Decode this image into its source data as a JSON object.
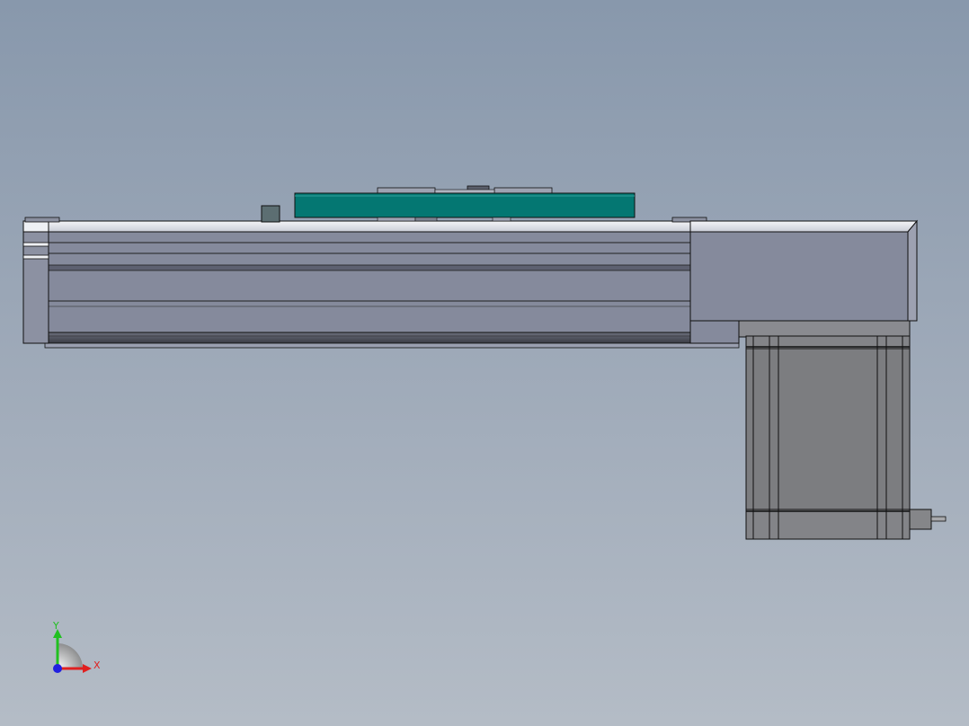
{
  "viewport": {
    "background_top": "#8898ac",
    "background_bottom": "#b4bcc6"
  },
  "model": {
    "parts": [
      "linear-actuator-body",
      "carriage-plate",
      "end-housing",
      "stepper-motor",
      "motor-shaft"
    ],
    "colors": {
      "body": "#858a9c",
      "body_dark": "#4a4d58",
      "carriage": "#047772",
      "motor": "#7c7d80",
      "edge": "#101010"
    }
  },
  "triad": {
    "x_label": "X",
    "y_label": "Y",
    "x_color": "#e02020",
    "y_color": "#20c020",
    "z_color": "#2020e0"
  }
}
